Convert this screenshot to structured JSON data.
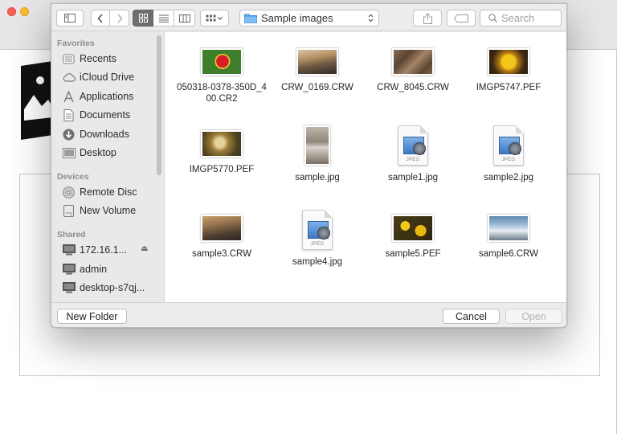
{
  "toolbar": {
    "location": "Sample images",
    "search_placeholder": "Search"
  },
  "sidebar": {
    "sections": [
      {
        "title": "Favorites",
        "items": [
          {
            "label": "Recents",
            "icon": "clock-icon"
          },
          {
            "label": "iCloud Drive",
            "icon": "cloud-icon"
          },
          {
            "label": "Applications",
            "icon": "applications-icon"
          },
          {
            "label": "Documents",
            "icon": "document-icon"
          },
          {
            "label": "Downloads",
            "icon": "download-icon"
          },
          {
            "label": "Desktop",
            "icon": "desktop-icon"
          }
        ]
      },
      {
        "title": "Devices",
        "items": [
          {
            "label": "Remote Disc",
            "icon": "disc-icon"
          },
          {
            "label": "New Volume",
            "icon": "drive-icon"
          }
        ]
      },
      {
        "title": "Shared",
        "items": [
          {
            "label": "172.16.1...",
            "icon": "computer-icon"
          },
          {
            "label": "admin",
            "icon": "computer-icon"
          },
          {
            "label": "desktop-s7qj...",
            "icon": "computer-icon"
          }
        ]
      }
    ]
  },
  "files": [
    {
      "name": "050318-0378-350D_400.CR2",
      "type": "photo",
      "colors": [
        "#c41a1a",
        "#3f7a28"
      ]
    },
    {
      "name": "CRW_0169.CRW",
      "type": "photo",
      "colors": [
        "#6f5a46",
        "#b7a184"
      ]
    },
    {
      "name": "CRW_8045.CRW",
      "type": "photo",
      "colors": [
        "#6a513d",
        "#9c7e62"
      ]
    },
    {
      "name": "IMGP5747.PEF",
      "type": "photo",
      "colors": [
        "#d8a216",
        "#4a3414"
      ]
    },
    {
      "name": "IMGP5770.PEF",
      "type": "photo",
      "colors": [
        "#7e6a2e",
        "#c9b27a"
      ]
    },
    {
      "name": "sample.jpg",
      "type": "portrait",
      "colors": [
        "#9d948b",
        "#d9d2c9"
      ]
    },
    {
      "name": "sample1.jpg",
      "type": "jpeg",
      "doc_label": "JPEG"
    },
    {
      "name": "sample2.jpg",
      "type": "jpeg",
      "doc_label": "JPEG"
    },
    {
      "name": "sample3.CRW",
      "type": "photo",
      "colors": [
        "#5a4a3a",
        "#c49a66"
      ]
    },
    {
      "name": "sample4.jpg",
      "type": "jpeg",
      "doc_label": "JPEG"
    },
    {
      "name": "sample5.PEF",
      "type": "photo",
      "colors": [
        "#e3b90f",
        "#3b3114"
      ]
    },
    {
      "name": "sample6.CRW",
      "type": "photo",
      "colors": [
        "#4f79a6",
        "#dfe7ef"
      ]
    }
  ],
  "footer": {
    "new_folder": "New Folder",
    "cancel": "Cancel",
    "open": "Open"
  }
}
